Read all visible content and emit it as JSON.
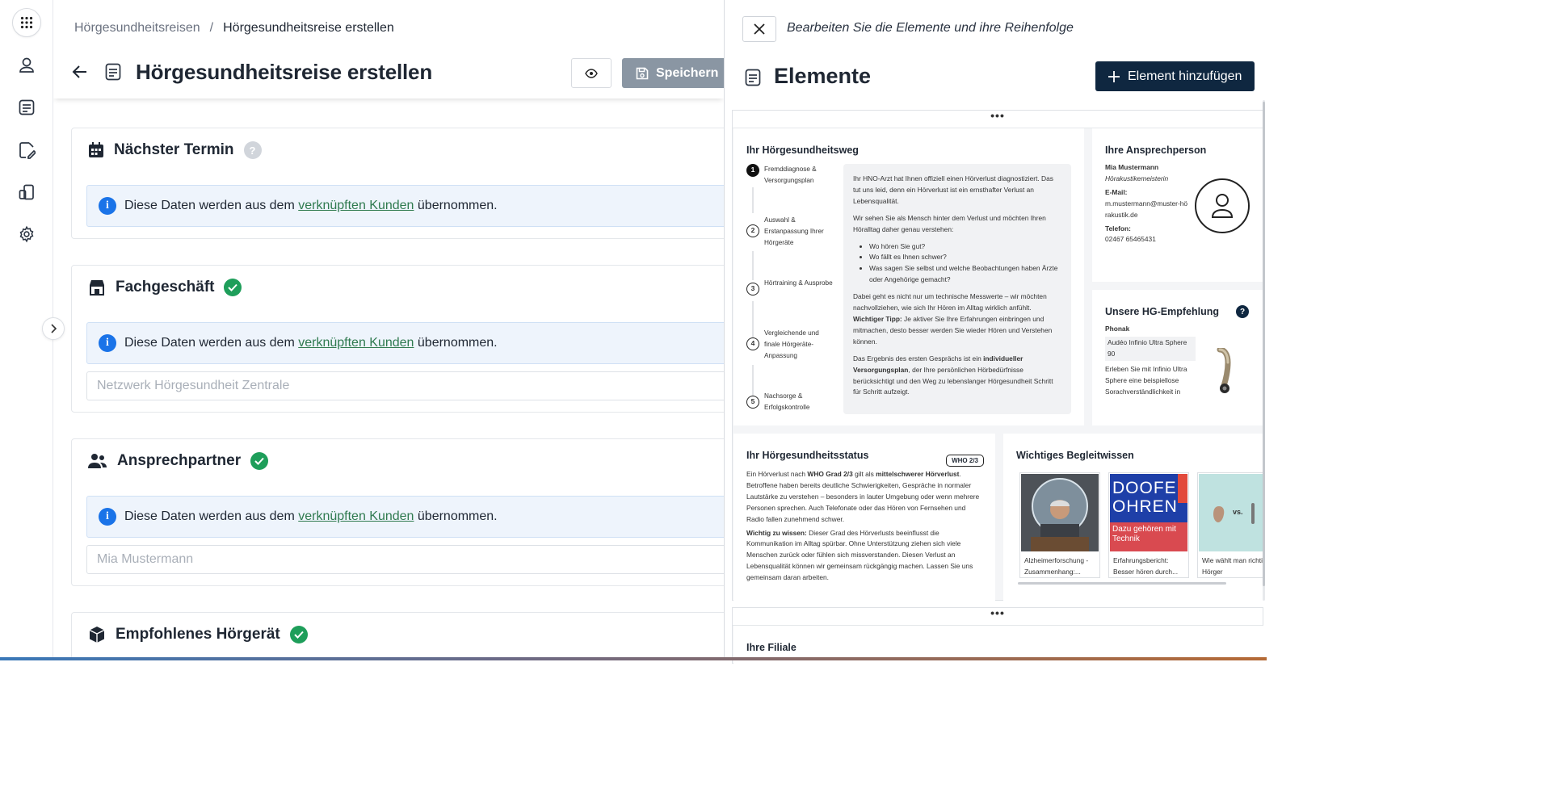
{
  "breadcrumb": {
    "parent": "Hörgesundheitsreisen",
    "separator": "/",
    "current": "Hörgesundheitsreise erstellen"
  },
  "page": {
    "title": "Hörgesundheitsreise erstellen",
    "save_label": "Speichern"
  },
  "sections": {
    "termin": {
      "title": "Nächster Termin",
      "help": "?"
    },
    "fach": {
      "title": "Fachgeschäft",
      "placeholder": "Netzwerk Hörgesundheit Zentrale"
    },
    "ansp": {
      "title": "Ansprechpartner",
      "placeholder": "Mia Mustermann"
    },
    "hg": {
      "title": "Empfohlenes Hörgerät"
    }
  },
  "info": {
    "pre": "Diese Daten werden aus dem",
    "link": "verknüpften Kunden",
    "post": "übernommen.",
    "badge": "i"
  },
  "panel": {
    "subtitle": "Bearbeiten Sie die Elemente und ihre Reihenfolge",
    "title": "Elemente",
    "add_label": "Element hinzufügen",
    "drag": "•••"
  },
  "weg": {
    "title": "Ihr Hörgesundheitsweg",
    "steps": [
      {
        "n": "1",
        "label": "Fremddiagnose & Versorgungsplan"
      },
      {
        "n": "2",
        "label": "Auswahl & Erstanpassung Ihrer Hörgeräte"
      },
      {
        "n": "3",
        "label": "Hörtraining & Ausprobe"
      },
      {
        "n": "4",
        "label": "Vergleichende und finale Hörgeräte-Anpassung"
      },
      {
        "n": "5",
        "label": "Nachsorge & Erfolgskontrolle"
      }
    ],
    "p1": "Ihr HNO-Arzt hat Ihnen offiziell einen Hörverlust diagnostiziert. Das tut uns leid, denn ein Hörverlust ist ein ernsthafter Verlust an Lebensqualität.",
    "p2": "Wir sehen Sie als Mensch hinter dem Verlust und möchten Ihren Höralltag daher genau verstehen:",
    "b1": "Wo hören Sie gut?",
    "b2": "Wo fällt es Ihnen schwer?",
    "b3": "Was sagen Sie selbst und welche Beobachtungen haben Ärzte oder Angehörige gemacht?",
    "p3": "Dabei geht es nicht nur um technische Messwerte – wir möchten nachvollziehen, wie sich Ihr Hören im Alltag wirklich anfühlt.",
    "tip_label": "Wichtiger Tipp:",
    "tip": "Je aktiver Sie Ihre Erfahrungen einbringen und mitmachen, desto besser werden Sie wieder Hören und Verstehen können.",
    "p4a": "Das Ergebnis des ersten Gesprächs ist ein",
    "p4b": "individueller Versorgungsplan",
    "p4c": ", der Ihre persönlichen Hörbedürfnisse berücksichtigt und den Weg zu lebenslanger Hörgesundheit Schritt für Schritt aufzeigt."
  },
  "contact": {
    "title": "Ihre Ansprechperson",
    "name": "Mia Mustermann",
    "role": "Hörakustikemeisterin",
    "email_label": "E-Mail:",
    "email": "m.mustermann@muster-hörakustik.de",
    "phone_label": "Telefon:",
    "phone": "02467 65465431"
  },
  "empf": {
    "title": "Unsere HG-Empfehlung",
    "help": "?",
    "brand": "Phonak",
    "model": "Audéo Infinio Ultra Sphere 90",
    "desc": "Erleben Sie mit Infinio Ultra Sphere eine beispiellose Sorachverständlichkeit in"
  },
  "status": {
    "title": "Ihr Hörgesundheitsstatus",
    "tag": "WHO 2/3",
    "t1": "Ein Hörverlust nach",
    "t1b": "WHO Grad 2/3",
    "t1c": "gilt als",
    "t1d": "mittelschwerer Hörverlust",
    "t1e": ". Betroffene haben bereits deutliche Schwierigkeiten, Gespräche in normaler Lautstärke zu verstehen – besonders in lauter Umgebung oder wenn mehrere Personen sprechen. Auch Telefonate oder das Hören von Fernsehen und Radio fallen zunehmend schwer.",
    "t2": "Wichtig zu wissen:",
    "t2b": "Dieser Grad des Hörverlusts beeinflusst die Kommunikation im Alltag spürbar. Ohne Unterstützung ziehen sich viele Menschen zurück oder fühlen sich missverstanden. Diesen Verlust an Lebensqualität können wir gemeinsam rückgängig machen. Lassen Sie uns gemeinsam daran arbeiten."
  },
  "wissen": {
    "title": "Wichtiges Begleitwissen",
    "items": [
      {
        "caption": "Alzheimerforschung - Zusammenhang:..."
      },
      {
        "caption": "Erfahrungsbericht: Besser hören durch...",
        "cover1": "DOOFE",
        "cover2": "OHREN",
        "cover3": "Dazu gehören mit Technik"
      },
      {
        "caption": "Wie wählt man richtige Hörger",
        "cover": "vs."
      }
    ]
  },
  "filiale": {
    "title": "Ihre Filiale"
  },
  "colors": {
    "accent": "#0f2740",
    "success": "#1e9e5a",
    "link": "#2f7a4f",
    "info_bg": "#eef4fc",
    "save_disabled": "#8a96a3"
  }
}
